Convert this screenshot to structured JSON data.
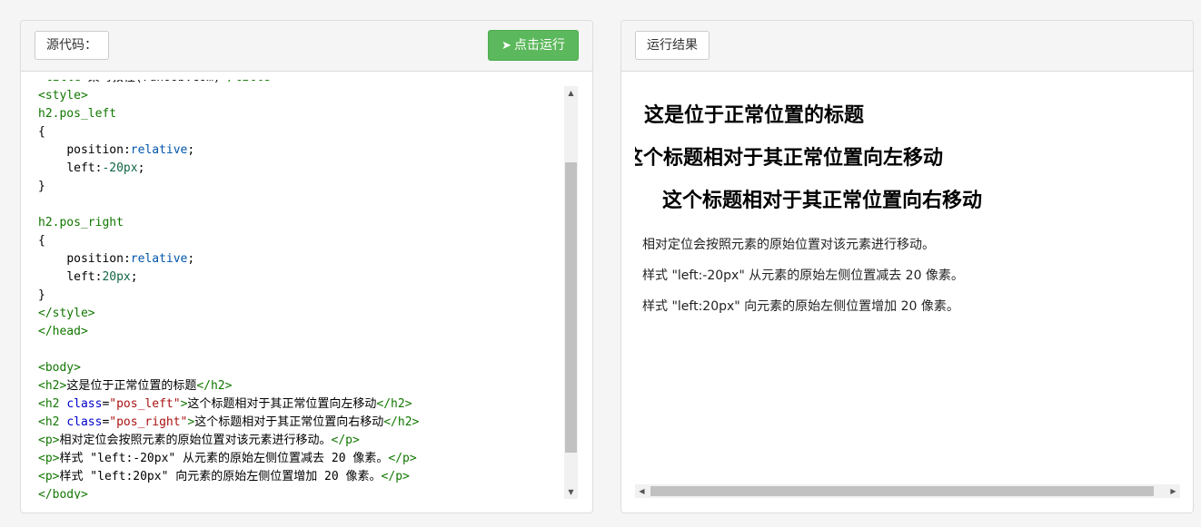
{
  "left_panel": {
    "tab_label": "源代码：",
    "run_button_label": "点击运行",
    "run_icon": "paper-plane-icon"
  },
  "right_panel": {
    "tab_label": "运行结果"
  },
  "code_lines": [
    "<title>菜鸟教程(runoob.com)</title>",
    "<style>",
    "h2.pos_left",
    "{",
    "    position:relative;",
    "    left:-20px;",
    "}",
    "",
    "h2.pos_right",
    "{",
    "    position:relative;",
    "    left:20px;",
    "}",
    "</style>",
    "</head>",
    "",
    "<body>",
    "<h2>这是位于正常位置的标题</h2>",
    "<h2 class=\"pos_left\">这个标题相对于其正常位置向左移动</h2>",
    "<h2 class=\"pos_right\">这个标题相对于其正常位置向右移动</h2>",
    "<p>相对定位会按照元素的原始位置对该元素进行移动。</p>",
    "<p>样式 \"left:-20px\" 从元素的原始左侧位置减去 20 像素。</p>",
    "<p>样式 \"left:20px\" 向元素的原始左侧位置增加 20 像素。</p>",
    "</body>"
  ],
  "result": {
    "heading_normal": "这是位于正常位置的标题",
    "heading_left": "这个标题相对于其正常位置向左移动",
    "heading_right": "这个标题相对于其正常位置向右移动",
    "para_1": "相对定位会按照元素的原始位置对该元素进行移动。",
    "para_2": "样式 \"left:-20px\" 从元素的原始左侧位置减去 20 像素。",
    "para_3": "样式 \"left:20px\" 向元素的原始左侧位置增加 20 像素。"
  },
  "colors": {
    "run_button": "#5cb85c",
    "tag": "#117700",
    "attribute": "#0000cc",
    "string": "#aa1111",
    "keyword": "#0055aa"
  }
}
